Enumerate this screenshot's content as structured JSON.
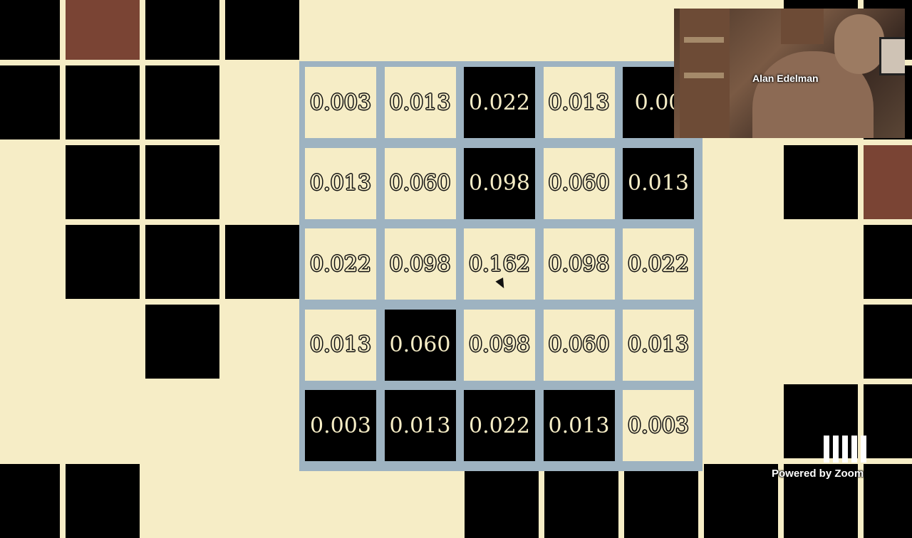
{
  "colors": {
    "cream": "#f6edc6",
    "black": "#000000",
    "brown": "#7a4434",
    "kernel_border": "#9eb3c1"
  },
  "background_grid": {
    "rows": [
      [
        "black",
        "brown",
        "black",
        "black",
        "cream",
        "cream",
        "cream",
        "cream",
        "cream",
        "cream",
        "black",
        "black"
      ],
      [
        "black",
        "black",
        "black",
        "cream",
        "cream",
        "cream",
        "cream",
        "cream",
        "cream",
        "cream",
        "cream",
        "black"
      ],
      [
        "cream",
        "black",
        "black",
        "cream",
        "cream",
        "cream",
        "cream",
        "cream",
        "cream",
        "cream",
        "black",
        "brown"
      ],
      [
        "cream",
        "black",
        "black",
        "black",
        "cream",
        "cream",
        "cream",
        "cream",
        "cream",
        "cream",
        "cream",
        "black"
      ],
      [
        "cream",
        "cream",
        "black",
        "cream",
        "cream",
        "cream",
        "cream",
        "cream",
        "cream",
        "cream",
        "cream",
        "black"
      ],
      [
        "cream",
        "cream",
        "cream",
        "cream",
        "cream",
        "cream",
        "cream",
        "cream",
        "cream",
        "cream",
        "black",
        "black"
      ],
      [
        "black",
        "black",
        "cream",
        "cream",
        "cream",
        "cream",
        "black",
        "black",
        "black",
        "black",
        "black",
        "black"
      ]
    ]
  },
  "kernel": {
    "cells": [
      [
        {
          "value": "0.003",
          "tone": "light"
        },
        {
          "value": "0.013",
          "tone": "light"
        },
        {
          "value": "0.022",
          "tone": "dark"
        },
        {
          "value": "0.013",
          "tone": "light"
        },
        {
          "value": "0.00",
          "tone": "dark"
        }
      ],
      [
        {
          "value": "0.013",
          "tone": "light"
        },
        {
          "value": "0.060",
          "tone": "light"
        },
        {
          "value": "0.098",
          "tone": "dark"
        },
        {
          "value": "0.060",
          "tone": "light"
        },
        {
          "value": "0.013",
          "tone": "dark"
        }
      ],
      [
        {
          "value": "0.022",
          "tone": "light"
        },
        {
          "value": "0.098",
          "tone": "light"
        },
        {
          "value": "0.162",
          "tone": "light"
        },
        {
          "value": "0.098",
          "tone": "light"
        },
        {
          "value": "0.022",
          "tone": "light"
        }
      ],
      [
        {
          "value": "0.013",
          "tone": "light"
        },
        {
          "value": "0.060",
          "tone": "dark"
        },
        {
          "value": "0.098",
          "tone": "light"
        },
        {
          "value": "0.060",
          "tone": "light"
        },
        {
          "value": "0.013",
          "tone": "light"
        }
      ],
      [
        {
          "value": "0.003",
          "tone": "dark"
        },
        {
          "value": "0.013",
          "tone": "dark"
        },
        {
          "value": "0.022",
          "tone": "dark"
        },
        {
          "value": "0.013",
          "tone": "dark"
        },
        {
          "value": "0.003",
          "tone": "light"
        }
      ]
    ]
  },
  "video": {
    "participant_name": "Alan Edelman"
  },
  "overlay": {
    "powered_by": "Powered by Zoom",
    "logo_icon": "mit-logo-icon"
  }
}
